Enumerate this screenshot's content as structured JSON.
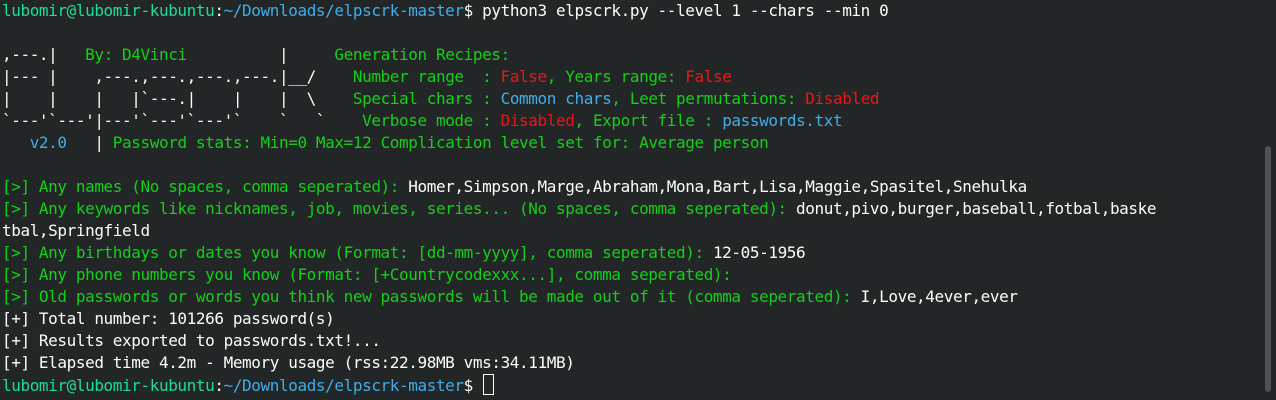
{
  "prompt": {
    "user_host": "lubomir@lubomir-kubuntu",
    "path": "~/Downloads/elpscrk-master",
    "symbol": "$"
  },
  "command": " python3 elpscrk.py --level 1 --chars --min 0",
  "banner": {
    "art1": ",---.|",
    "art1_by": "By: D4Vinci",
    "art2": "|--- |    ,---.,---.,---.,---.|__/",
    "art3": "|    |    |   |`---.|    |    |  \\",
    "art4": "`---'`---'|---'`---'`---'`    `   `",
    "version": "   v2.0   ",
    "pipe": "|",
    "recipes_title": "Generation Recipes:",
    "number_range_label": "Number range  : ",
    "number_range_value": "False",
    "years_range_label": "Years range: ",
    "years_range_value": "False",
    "special_chars_label": "Special chars : ",
    "special_chars_value": "Common chars",
    "leet_label": "Leet permutations: ",
    "leet_value": "Disabled",
    "verbose_label": "Verbose mode : ",
    "verbose_value": "Disabled",
    "export_label": "Export file : ",
    "export_value": "passwords.txt",
    "stats_text": " Password stats: Min=0 Max=12 Complication level set for: Average person"
  },
  "qa": [
    {
      "question": "[>] Any names (No spaces, comma seperated): ",
      "answer": "Homer,Simpson,Marge,Abraham,Mona,Bart,Lisa,Maggie,Spasitel,Snehulka"
    },
    {
      "question": "[>] Any keywords like nicknames, job, movies, series... (No spaces, comma seperated): ",
      "answer": "donut,pivo,burger,baseball,fotbal,baske",
      "answer_wrap": "tbal,Springfield"
    },
    {
      "question": "[>] Any birthdays or dates you know (Format: [dd-mm-yyyy], comma seperated): ",
      "answer": "12-05-1956"
    },
    {
      "question": "[>] Any phone numbers you know (Format: [+Countrycodexxx...], comma seperated):",
      "answer": ""
    },
    {
      "question": "[>] Old passwords or words you think new passwords will be made out of it (comma seperated): ",
      "answer": "I,Love,4ever,ever"
    }
  ],
  "results": [
    "[+] Total number: 101266 password(s)",
    "[+] Results exported to passwords.txt!...",
    "[+] Elapsed time 4.2m - Memory usage (rss:22.98MB vms:34.11MB)"
  ],
  "colors": {
    "background": "#232627",
    "green": "#11d116",
    "blue": "#3daee9",
    "red": "#ed1515",
    "foreground": "#fcfcfc",
    "prompt_user": "#1cdc9a"
  }
}
